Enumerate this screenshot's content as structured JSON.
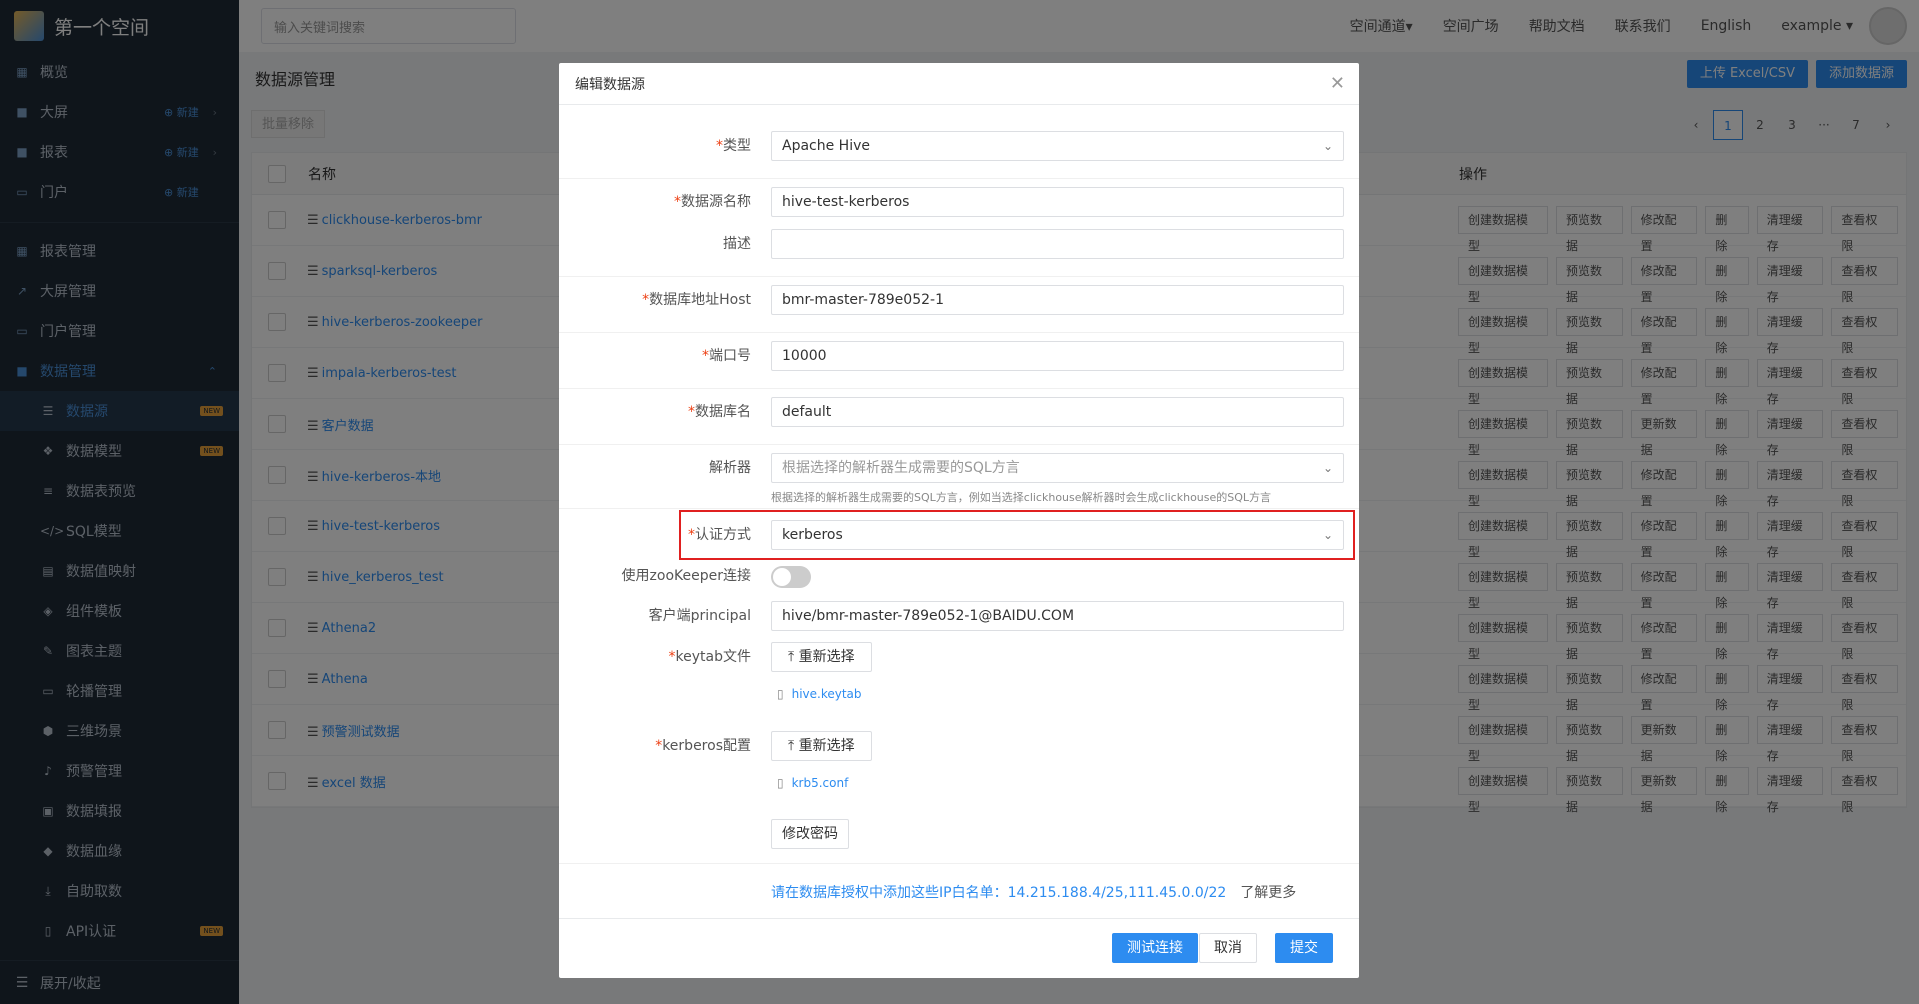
{
  "app": {
    "title": "第一个空间"
  },
  "sidebar": {
    "top_items": [
      {
        "label": "概览",
        "icon": "grid-icon"
      },
      {
        "label": "大屏",
        "icon": "folder-icon",
        "new": "新建"
      },
      {
        "label": "报表",
        "icon": "folder-icon",
        "new": "新建"
      },
      {
        "label": "门户",
        "icon": "portal-icon",
        "new": "新建"
      }
    ],
    "mgmt_items": [
      {
        "label": "报表管理"
      },
      {
        "label": "大屏管理"
      },
      {
        "label": "门户管理"
      },
      {
        "label": "数据管理"
      }
    ],
    "sub_items": [
      {
        "label": "数据源",
        "badge": "NEW"
      },
      {
        "label": "数据模型",
        "badge": "NEW"
      },
      {
        "label": "数据表预览"
      },
      {
        "label": "SQL模型"
      },
      {
        "label": "数据值映射"
      },
      {
        "label": "组件模板"
      },
      {
        "label": "图表主题"
      },
      {
        "label": "轮播管理"
      },
      {
        "label": "三维场景"
      },
      {
        "label": "预警管理"
      },
      {
        "label": "数据填报"
      },
      {
        "label": "数据血缘"
      },
      {
        "label": "自助取数"
      },
      {
        "label": "API认证",
        "badge": "NEW"
      }
    ],
    "footer": "展开/收起"
  },
  "topbar": {
    "search_placeholder": "输入关键词搜索",
    "links": [
      "空间通道▾",
      "空间广场",
      "帮助文档",
      "联系我们",
      "English",
      "example ▾"
    ]
  },
  "page": {
    "title": "数据源管理",
    "upload_btn": "上传 Excel/CSV",
    "add_btn": "添加数据源",
    "batch_remove": "批量移除",
    "pagination": [
      "‹",
      "1",
      "2",
      "3",
      "···",
      "7",
      "›"
    ],
    "col_name": "名称",
    "col_ops": "操作"
  },
  "table": {
    "rows": [
      {
        "name": "clickhouse-kerberos-bmr",
        "ops": [
          "创建数据模型",
          "预览数据",
          "修改配置",
          "删除",
          "清理缓存",
          "查看权限"
        ]
      },
      {
        "name": "sparksql-kerberos",
        "ops": [
          "创建数据模型",
          "预览数据",
          "修改配置",
          "删除",
          "清理缓存",
          "查看权限"
        ]
      },
      {
        "name": "hive-kerberos-zookeeper",
        "ops": [
          "创建数据模型",
          "预览数据",
          "修改配置",
          "删除",
          "清理缓存",
          "查看权限"
        ]
      },
      {
        "name": "impala-kerberos-test",
        "ops": [
          "创建数据模型",
          "预览数据",
          "修改配置",
          "删除",
          "清理缓存",
          "查看权限"
        ]
      },
      {
        "name": "客户数据",
        "ops": [
          "创建数据模型",
          "预览数据",
          "更新数据",
          "删除",
          "清理缓存",
          "查看权限"
        ]
      },
      {
        "name": "hive-kerberos-本地",
        "ops": [
          "创建数据模型",
          "预览数据",
          "修改配置",
          "删除",
          "清理缓存",
          "查看权限"
        ]
      },
      {
        "name": "hive-test-kerberos",
        "ops": [
          "创建数据模型",
          "预览数据",
          "修改配置",
          "删除",
          "清理缓存",
          "查看权限"
        ]
      },
      {
        "name": "hive_kerberos_test",
        "ops": [
          "创建数据模型",
          "预览数据",
          "修改配置",
          "删除",
          "清理缓存",
          "查看权限"
        ]
      },
      {
        "name": "Athena2",
        "ops": [
          "创建数据模型",
          "预览数据",
          "修改配置",
          "删除",
          "清理缓存",
          "查看权限"
        ]
      },
      {
        "name": "Athena",
        "ops": [
          "创建数据模型",
          "预览数据",
          "修改配置",
          "删除",
          "清理缓存",
          "查看权限"
        ]
      },
      {
        "name": "预警测试数据",
        "ops": [
          "创建数据模型",
          "预览数据",
          "更新数据",
          "删除",
          "清理缓存",
          "查看权限"
        ]
      },
      {
        "name": "excel 数据",
        "ops": [
          "创建数据模型",
          "预览数据",
          "更新数据",
          "删除",
          "清理缓存",
          "查看权限"
        ]
      }
    ]
  },
  "modal": {
    "title": "编辑数据源",
    "type_label": "类型",
    "type_value": "Apache Hive",
    "name_label": "数据源名称",
    "name_value": "hive-test-kerberos",
    "desc_label": "描述",
    "desc_value": "",
    "host_label": "数据库地址Host",
    "host_value": "bmr-master-789e052-1",
    "port_label": "端口号",
    "port_value": "10000",
    "db_label": "数据库名",
    "db_value": "default",
    "parser_label": "解析器",
    "parser_placeholder": "根据选择的解析器生成需要的SQL方言",
    "parser_hint": "根据选择的解析器生成需要的SQL方言，例如当选择clickhouse解析器时会生成clickhouse的SQL方言",
    "auth_label": "认证方式",
    "auth_value": "kerberos",
    "zk_label": "使用zooKeeper连接",
    "principal_label": "客户端principal",
    "principal_value": "hive/bmr-master-789e052-1@BAIDU.COM",
    "keytab_label": "keytab文件",
    "reselect": "重新选择",
    "keytab_file": "hive.keytab",
    "krb_label": "kerberos配置",
    "krb_file": "krb5.conf",
    "change_pwd": "修改密码",
    "whitelist": "请在数据库授权中添加这些IP白名单：14.215.188.4/25,111.45.0.0/22",
    "learn_more": "了解更多",
    "test_btn": "测试连接",
    "cancel_btn": "取消",
    "submit_btn": "提交"
  }
}
